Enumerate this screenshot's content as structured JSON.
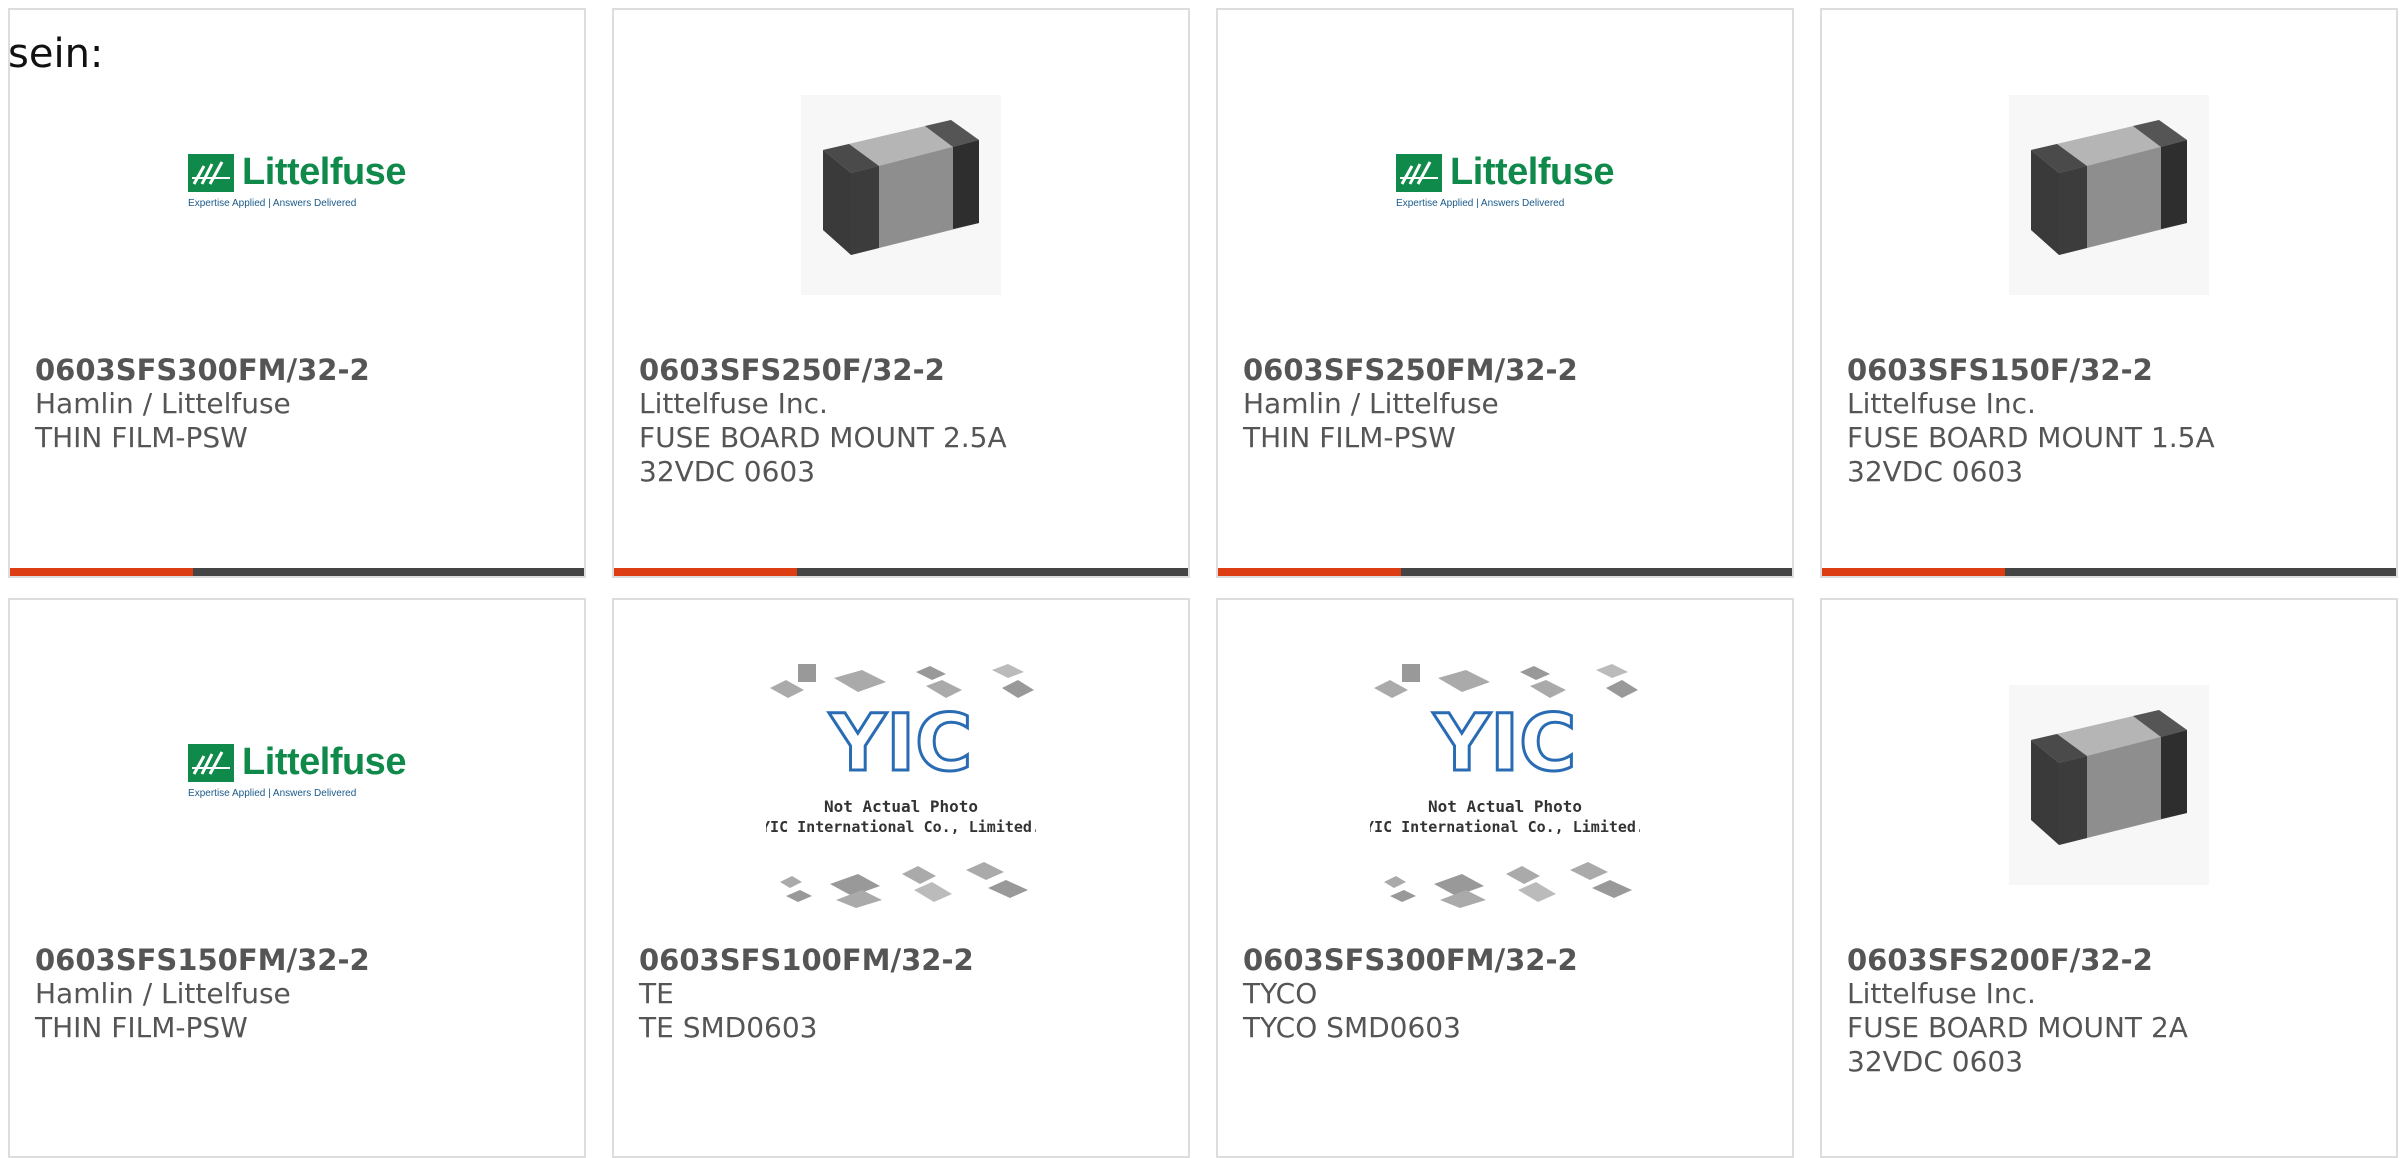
{
  "intro_text": "sein:",
  "logo": {
    "brand": "Littelfuse",
    "tagline": "Expertise Applied | Answers Delivered"
  },
  "yic_placeholder": {
    "monogram": "YIC",
    "line1": "Not Actual Photo",
    "line2": "YIC International Co., Limited."
  },
  "colors": {
    "accent": "#dd3d12",
    "bar": "#444444",
    "text": "#555555",
    "littelfuse_green": "#0f8a4a"
  },
  "products": [
    {
      "part": "0603SFS300FM/32-2",
      "maker": "Hamlin / Littelfuse",
      "desc": "THIN FILM-PSW",
      "image": "littelfuse-logo"
    },
    {
      "part": "0603SFS250F/32-2",
      "maker": "Littelfuse Inc.",
      "desc": "FUSE BOARD MOUNT 2.5A 32VDC 0603",
      "image": "chip-fuse-photo"
    },
    {
      "part": "0603SFS250FM/32-2",
      "maker": "Hamlin / Littelfuse",
      "desc": "THIN FILM-PSW",
      "image": "littelfuse-logo"
    },
    {
      "part": "0603SFS150F/32-2",
      "maker": "Littelfuse Inc.",
      "desc": "FUSE BOARD MOUNT 1.5A 32VDC 0603",
      "image": "chip-fuse-photo"
    },
    {
      "part": "0603SFS150FM/32-2",
      "maker": "Hamlin / Littelfuse",
      "desc": "THIN FILM-PSW",
      "image": "littelfuse-logo"
    },
    {
      "part": "0603SFS100FM/32-2",
      "maker": "TE",
      "desc": "TE SMD0603",
      "image": "yic-placeholder"
    },
    {
      "part": "0603SFS300FM/32-2",
      "maker": "TYCO",
      "desc": "TYCO SMD0603",
      "image": "yic-placeholder"
    },
    {
      "part": "0603SFS200F/32-2",
      "maker": "Littelfuse Inc.",
      "desc": "FUSE BOARD MOUNT 2A 32VDC 0603",
      "image": "chip-fuse-photo"
    }
  ]
}
